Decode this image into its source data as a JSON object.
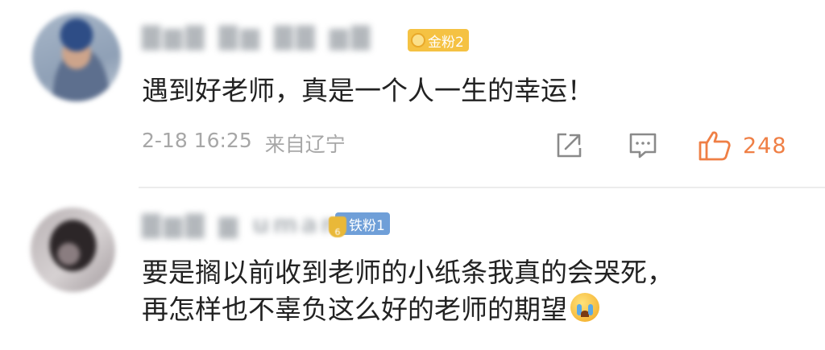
{
  "comments": [
    {
      "username": "▇▆▇ ▇▆ ▇▇ ▆▇",
      "fan_badge": "金粉2",
      "text_lines": [
        "遇到好老师，真是一个人一生的幸运！"
      ],
      "timestamp": "2-18 16:25",
      "location": "来自辽宁",
      "like_count": "248",
      "icons": [
        "avatar",
        "share-icon",
        "comment-icon",
        "thumbs-up-icon"
      ]
    },
    {
      "username": "▇▆▇ ▆ uman",
      "fan_badge": "铁粉1",
      "fan_badge_sub": "6",
      "text_lines": [
        "要是搁以前收到老师的小纸条我真的会哭死，",
        "再怎样也不辜负这么好的老师的期望"
      ],
      "icons": [
        "avatar",
        "crying-emoji-icon"
      ]
    }
  ],
  "colors": {
    "accent_like": "#ef7f45",
    "meta_gray": "#a7a7a7",
    "gold_badge": "#f5c243",
    "iron_badge": "#6f9fd8"
  }
}
